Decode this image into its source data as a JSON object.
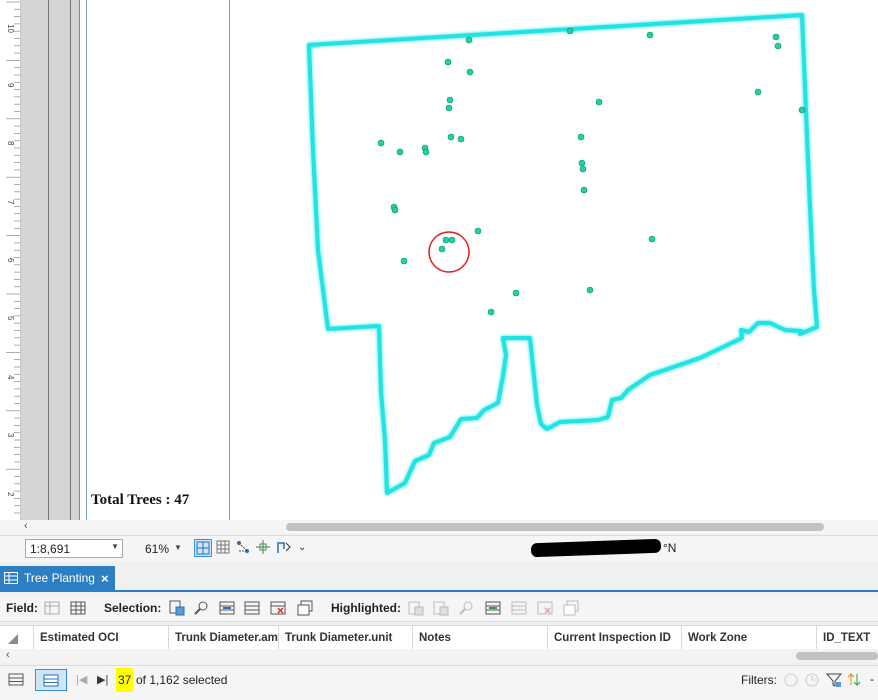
{
  "layout": {
    "total_trees_label": "Total Trees : 47",
    "ruler_labels": [
      "2",
      "3",
      "4",
      "5",
      "6",
      "7",
      "8",
      "9",
      "10"
    ]
  },
  "map": {
    "boundary_color": "#22e3e3",
    "point_color": "#1fd1a5",
    "highlight_circle_color": "#e02020"
  },
  "statusbar": {
    "scale_value": "1:8,691",
    "zoom_value": "61%",
    "coordinate_suffix": "°N"
  },
  "pane": {
    "tab_label": "Tree Planting",
    "close_icon": "×"
  },
  "toolbar": {
    "field_label": "Field:",
    "selection_label": "Selection:",
    "highlighted_label": "Highlighted:"
  },
  "table": {
    "columns": [
      "Estimated OCI",
      "Trunk Diameter.amt",
      "Trunk Diameter.unit",
      "Notes",
      "Current Inspection ID",
      "Work Zone",
      "ID_TEXT"
    ]
  },
  "bottombar": {
    "selected_count": "37",
    "selected_text": " of 1,162 selected",
    "filters_label": "Filters:"
  },
  "colors": {
    "accent": "#2d7fc4",
    "highlight_yellow": "#ffff00"
  }
}
